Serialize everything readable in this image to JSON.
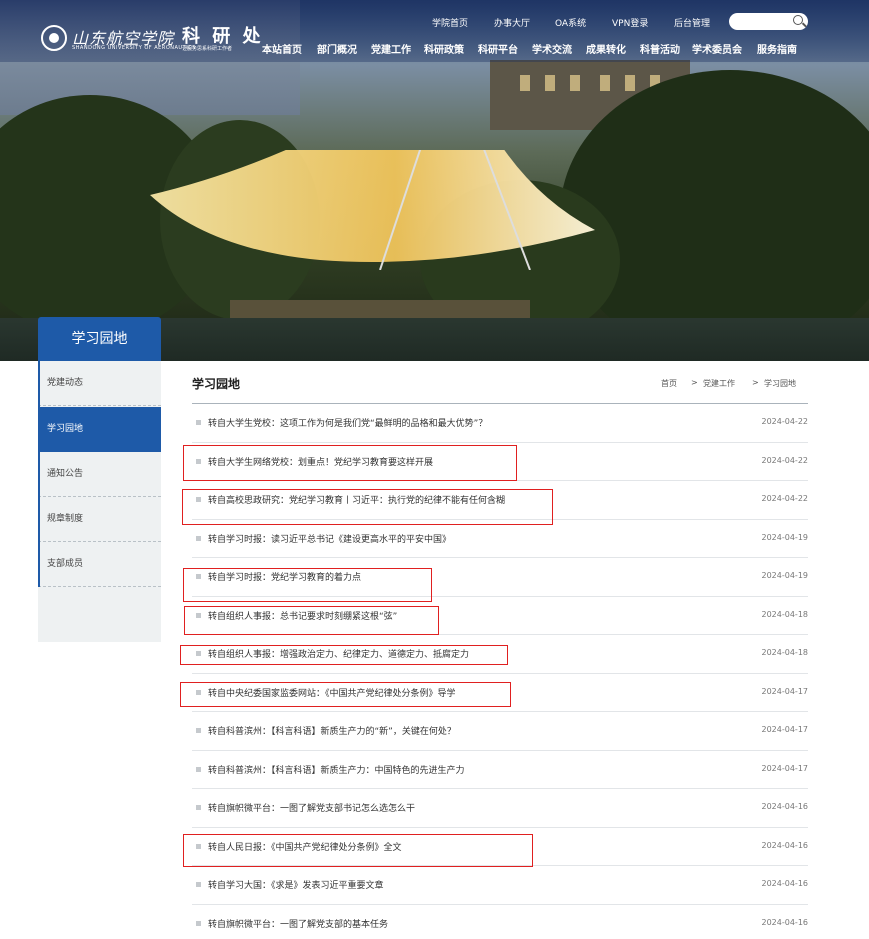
{
  "header": {
    "logo_cn": "山东航空学院",
    "logo_en": "SHANDONG UNIVERSITY OF AERONAUTICS",
    "dept_name": "科 研 处",
    "dept_sub": "让服务思系科研工作者",
    "util_links": [
      "学院首页",
      "办事大厅",
      "OA系统",
      "VPN登录",
      "后台管理"
    ],
    "search": {
      "placeholder": ""
    },
    "nav": [
      "本站首页",
      "部门概况",
      "党建工作",
      "科研政策",
      "科研平台",
      "学术交流",
      "成果转化",
      "科普活动",
      "学术委员会",
      "服务指南"
    ]
  },
  "sidebar": {
    "title": "学习园地",
    "items": [
      {
        "label": "党建动态",
        "active": false
      },
      {
        "label": "学习园地",
        "active": true
      },
      {
        "label": "通知公告",
        "active": false
      },
      {
        "label": "规章制度",
        "active": false
      },
      {
        "label": "支部成员",
        "active": false
      }
    ]
  },
  "content": {
    "title": "学习园地",
    "breadcrumb": [
      "首页",
      ">",
      "党建工作",
      ">",
      "学习园地"
    ],
    "articles": [
      {
        "title": "转自大学生党校：这项工作为何是我们党“最鲜明的品格和最大优势”？",
        "date": "2024-04-22"
      },
      {
        "title": "转自大学生网络党校：划重点！党纪学习教育要这样开展",
        "date": "2024-04-22"
      },
      {
        "title": "转自高校思政研究：党纪学习教育丨习近平：执行党的纪律不能有任何含糊",
        "date": "2024-04-22"
      },
      {
        "title": "转自学习时报：读习近平总书记《建设更高水平的平安中国》",
        "date": "2024-04-19"
      },
      {
        "title": "转自学习时报：党纪学习教育的着力点",
        "date": "2024-04-19"
      },
      {
        "title": "转自组织人事报：总书记要求时刻绷紧这根“弦”",
        "date": "2024-04-18"
      },
      {
        "title": "转自组织人事报：增强政治定力、纪律定力、道德定力、抵腐定力",
        "date": "2024-04-18"
      },
      {
        "title": "转自中央纪委国家监委网站：《中国共产党纪律处分条例》导学",
        "date": "2024-04-17"
      },
      {
        "title": "转自科普滨州：【科言科语】新质生产力的“新”，关键在何处？",
        "date": "2024-04-17"
      },
      {
        "title": "转自科普滨州：【科言科语】新质生产力：中国特色的先进生产力",
        "date": "2024-04-17"
      },
      {
        "title": "转自旗帜微平台：一图了解党支部书记怎么选怎么干",
        "date": "2024-04-16"
      },
      {
        "title": "转自人民日报：《中国共产党纪律处分条例》全文",
        "date": "2024-04-16"
      },
      {
        "title": "转自学习大国：《求是》发表习近平重要文章",
        "date": "2024-04-16"
      },
      {
        "title": "转自旗帜微平台：一图了解党支部的基本任务",
        "date": "2024-04-16"
      }
    ]
  },
  "colors": {
    "accent": "#1e5aa8",
    "highlight_box": "#e02020"
  }
}
